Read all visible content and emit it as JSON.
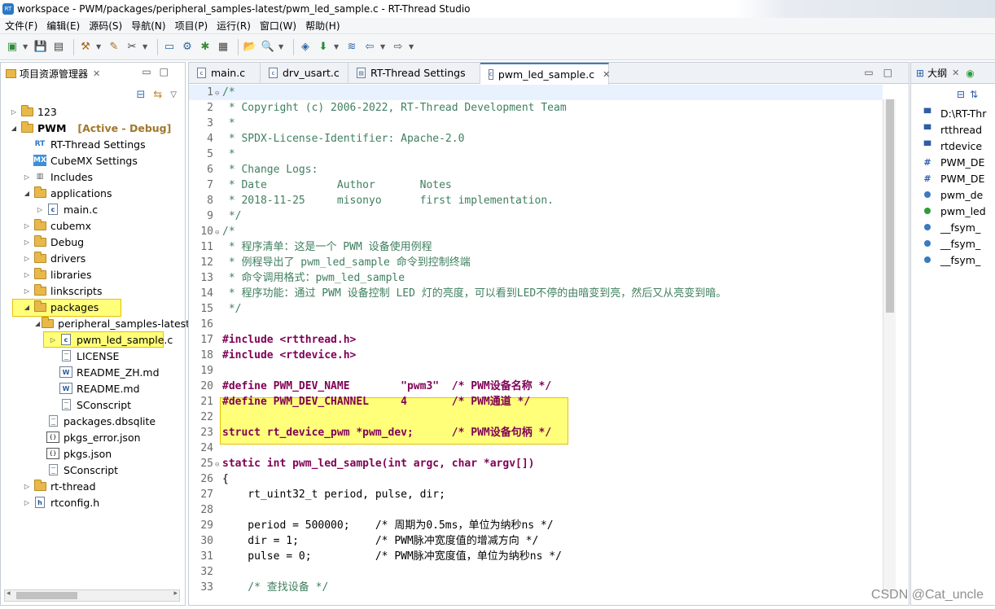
{
  "window": {
    "title": "workspace - PWM/packages/peripheral_samples-latest/pwm_led_sample.c - RT-Thread Studio"
  },
  "menu": [
    "文件(F)",
    "编辑(E)",
    "源码(S)",
    "导航(N)",
    "项目(P)",
    "运行(R)",
    "窗口(W)",
    "帮助(H)"
  ],
  "explorer": {
    "title": "项目资源管理器",
    "items": [
      {
        "label": "123",
        "extra": ""
      },
      {
        "label": "PWM",
        "extra": "[Active - Debug]"
      },
      {
        "label": "RT-Thread Settings"
      },
      {
        "label": "CubeMX Settings"
      },
      {
        "label": "Includes"
      },
      {
        "label": "applications"
      },
      {
        "label": "main.c"
      },
      {
        "label": "cubemx"
      },
      {
        "label": "Debug"
      },
      {
        "label": "drivers"
      },
      {
        "label": "libraries"
      },
      {
        "label": "linkscripts"
      },
      {
        "label": "packages"
      },
      {
        "label": "peripheral_samples-latest"
      },
      {
        "label": "pwm_led_sample.c"
      },
      {
        "label": "LICENSE"
      },
      {
        "label": "README_ZH.md"
      },
      {
        "label": "README.md"
      },
      {
        "label": "SConscript"
      },
      {
        "label": "packages.dbsqlite"
      },
      {
        "label": "pkgs_error.json"
      },
      {
        "label": "pkgs.json"
      },
      {
        "label": "SConscript"
      },
      {
        "label": "rt-thread"
      },
      {
        "label": "rtconfig.h"
      }
    ]
  },
  "editor": {
    "tabs": [
      "main.c",
      "drv_usart.c",
      "RT-Thread Settings",
      "pwm_led_sample.c"
    ],
    "lines": [
      "/*",
      " * Copyright (c) 2006-2022, RT-Thread Development Team",
      " *",
      " * SPDX-License-Identifier: Apache-2.0",
      " *",
      " * Change Logs:",
      " * Date           Author       Notes",
      " * 2018-11-25     misonyo      first implementation.",
      " */",
      "/*",
      " * 程序清单：这是一个 PWM 设备使用例程",
      " * 例程导出了 pwm_led_sample 命令到控制终端",
      " * 命令调用格式：pwm_led_sample",
      " * 程序功能：通过 PWM 设备控制 LED 灯的亮度，可以看到LED不停的由暗变到亮，然后又从亮变到暗。",
      " */",
      "",
      "#include <rtthread.h>",
      "#include <rtdevice.h>",
      "",
      "#define PWM_DEV_NAME        \"pwm3\"  /* PWM设备名称 */",
      "#define PWM_DEV_CHANNEL     4       /* PWM通道 */",
      "",
      "struct rt_device_pwm *pwm_dev;      /* PWM设备句柄 */",
      "",
      "static int pwm_led_sample(int argc, char *argv[])",
      "{",
      "    rt_uint32_t period, pulse, dir;",
      "",
      "    period = 500000;    /* 周期为0.5ms，单位为纳秒ns */",
      "    dir = 1;            /* PWM脉冲宽度值的增减方向 */",
      "    pulse = 0;          /* PWM脉冲宽度值，单位为纳秒ns */",
      "",
      "    /* 查找设备 */"
    ]
  },
  "outline": {
    "title": "大纲",
    "items": [
      "D:\\RT-Thr",
      "rtthread",
      "rtdevice",
      "PWM_DE",
      "PWM_DE",
      "pwm_de",
      "pwm_led",
      "__fsym_",
      "__fsym_",
      "__fsym_"
    ]
  },
  "watermark": "CSDN @Cat_uncle"
}
